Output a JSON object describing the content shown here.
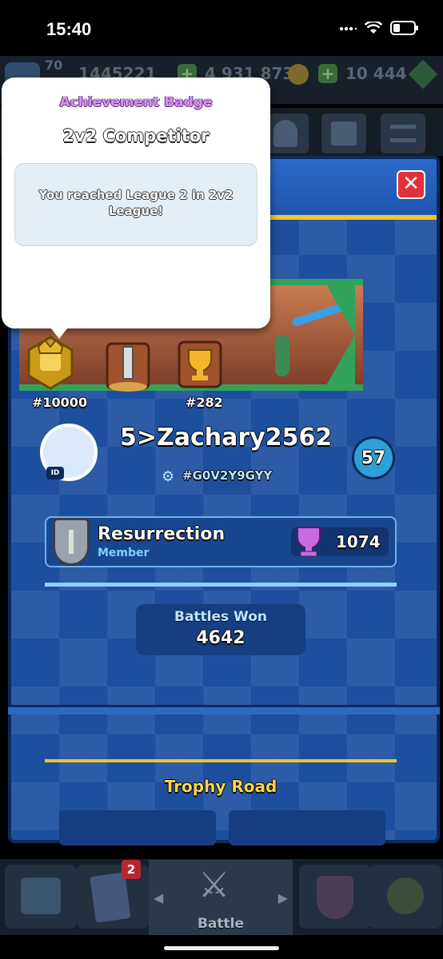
{
  "status_bar": {
    "time": "15:40"
  },
  "top_bar": {
    "level": "70",
    "trophies": "1445221",
    "gold": "4 931 873",
    "gems": "10 444"
  },
  "profile": {
    "badges": [
      {
        "name": "badge-2v2-league",
        "label": "#10000"
      },
      {
        "name": "badge-tournament",
        "label": ""
      },
      {
        "name": "badge-trophy",
        "label": "#282"
      }
    ],
    "id_chip": "ID",
    "player_name": "5>Zachary2562",
    "player_tag": "#G0V2Y9GYY",
    "level": "57",
    "clan_name": "Resurrection",
    "clan_role": "Member",
    "clan_trophies": "1074",
    "battles_won_label": "Battles Won",
    "battles_won": "4642",
    "trophy_road_title": "Trophy Road"
  },
  "tooltip": {
    "title": "Achievement Badge",
    "subtitle": "2v2 Competitor",
    "description": "You reached League 2 in 2v2 League!"
  },
  "bottom_nav": {
    "cards_notification": "2",
    "battle_label": "Battle"
  },
  "colors": {
    "panel_blue": "#1d4f9e",
    "accent_yellow": "#f1c231",
    "close_red": "#e2313a",
    "tooltip_title_purple": "#d792f2"
  }
}
